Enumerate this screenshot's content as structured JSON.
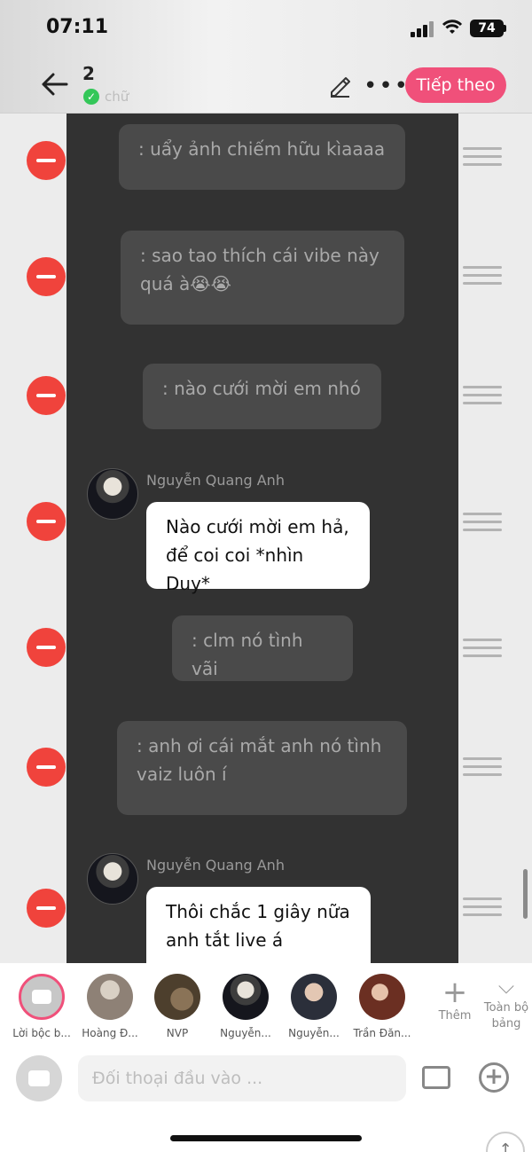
{
  "status_bar": {
    "time": "07:11",
    "battery": "74"
  },
  "header": {
    "count": "2",
    "subtitle": "chữ",
    "next_button": "Tiếp theo"
  },
  "messages": [
    {
      "type": "narration",
      "text": ": uẩy ảnh chiếm hữu kìaaaa"
    },
    {
      "type": "narration",
      "text": ": sao tao thích cái vibe này quá à😭😭"
    },
    {
      "type": "narration",
      "text": ": nào cưới mời em nhó"
    },
    {
      "type": "character",
      "sender": "Nguyễn Quang Anh",
      "text": "Nào cưới mời em hả, để coi coi *nhìn Duy*"
    },
    {
      "type": "narration",
      "text": ": clm nó tình vãi"
    },
    {
      "type": "narration",
      "text": ": anh ơi cái mắt anh nó tình vaiz luôn í"
    },
    {
      "type": "character",
      "sender": "Nguyễn Quang Anh",
      "text": "Thôi chắc 1 giây nữa anh tắt live á"
    }
  ],
  "characters": [
    {
      "name": "Lời bộc b...",
      "color": "#c7c7c7"
    },
    {
      "name": "Hoàng Đ...",
      "color": "#9c8e84"
    },
    {
      "name": "NVP",
      "color": "#6b5a44"
    },
    {
      "name": "Nguyễn...",
      "color": "#1b1c24"
    },
    {
      "name": "Nguyễn...",
      "color": "#2b2f3a"
    },
    {
      "name": "Trần Đăn...",
      "color": "#5a2b22"
    }
  ],
  "strip_actions": {
    "add_label": "Thêm",
    "all_label": "Toàn bộ bảng"
  },
  "input": {
    "placeholder": "Đối thoại đầu vào ..."
  }
}
